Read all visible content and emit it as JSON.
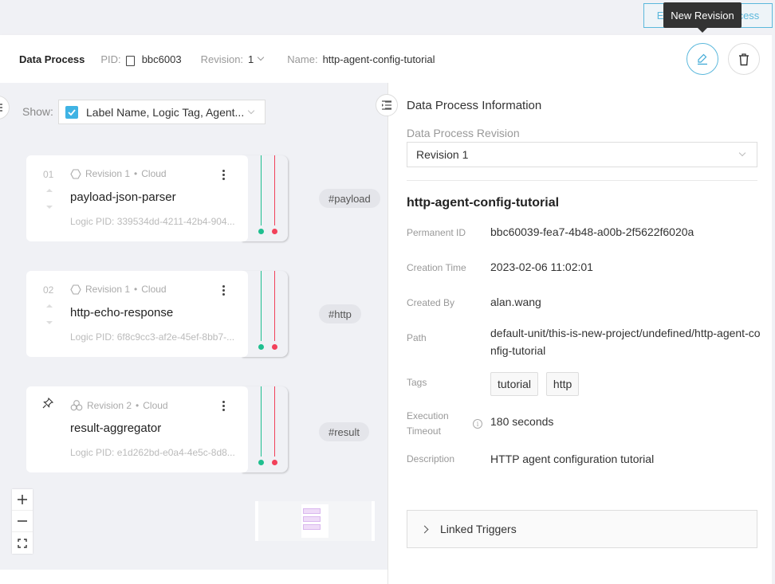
{
  "topbar": {
    "execute_button_label": "Execute Data Process",
    "tooltip": "New Revision"
  },
  "header": {
    "title": "Data Process",
    "pid_label": "PID:",
    "pid_value": "bbc6003",
    "revision_label": "Revision:",
    "revision_value": "1",
    "name_label": "Name:",
    "name_value": "http-agent-config-tutorial",
    "actions": [
      {
        "name": "new-revision",
        "icon": "pencil-icon",
        "accent": "#5bb8dc"
      },
      {
        "name": "delete",
        "icon": "trash-icon"
      }
    ]
  },
  "canvas": {
    "show_label": "Show:",
    "show_select_value": "Label Name, Logic Tag, Agent...",
    "show_checked": true,
    "nodes": [
      {
        "index": "01",
        "revision": "Revision 1",
        "location": "Cloud",
        "icon": "hexagon-icon",
        "name": "payload-json-parser",
        "logic_pid": "Logic PID: 339534dd-4211-42b4-904...",
        "tag": "#payload",
        "pinned": false
      },
      {
        "index": "02",
        "revision": "Revision 1",
        "location": "Cloud",
        "icon": "hexagon-icon",
        "name": "http-echo-response",
        "logic_pid": "Logic PID: 6f8c9cc3-af2e-45ef-8bb7-...",
        "tag": "#http",
        "pinned": false
      },
      {
        "index": "",
        "revision": "Revision 2",
        "location": "Cloud",
        "icon": "cluster-icon",
        "name": "result-aggregator",
        "logic_pid": "Logic PID: e1d262bd-e0a4-4e5c-8d8...",
        "tag": "#result",
        "pinned": true
      }
    ],
    "zoom_controls": [
      "+",
      "−",
      "fit"
    ],
    "port_colors": {
      "output": "#1fbf8f",
      "error": "#f2415a"
    }
  },
  "panel": {
    "title": "Data Process Information",
    "revision_label": "Data Process Revision",
    "revision_value": "Revision 1",
    "name": "http-agent-config-tutorial",
    "fields": {
      "permanent_id": {
        "label": "Permanent ID",
        "value": "bbc60039-fea7-4b48-a00b-2f5622f6020a"
      },
      "creation_time": {
        "label": "Creation Time",
        "value": "2023-02-06 11:02:01"
      },
      "created_by": {
        "label": "Created By",
        "value": "alan.wang"
      },
      "path": {
        "label": "Path",
        "value": "default-unit/this-is-new-project/undefined/http-agent-config-tutorial"
      },
      "tags": {
        "label": "Tags",
        "values": [
          "tutorial",
          "http"
        ]
      },
      "timeout": {
        "label_line1": "Execution",
        "label_line2": "Timeout",
        "value": "180 seconds"
      },
      "description": {
        "label": "Description",
        "value": "HTTP agent configuration tutorial"
      }
    },
    "linked_triggers_label": "Linked Triggers"
  }
}
